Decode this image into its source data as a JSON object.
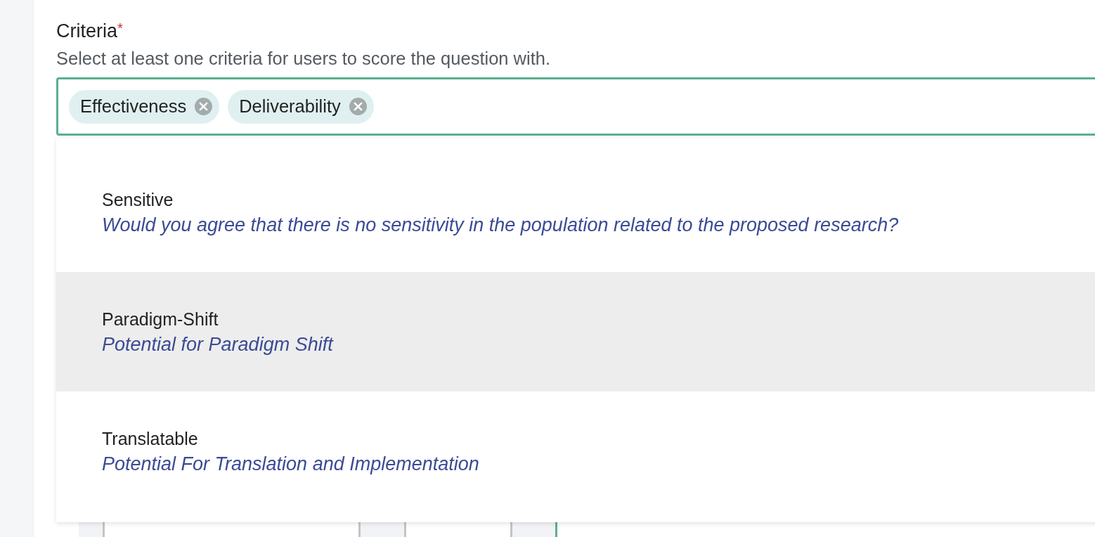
{
  "field": {
    "label": "Criteria",
    "required_mark": "*",
    "hint": "Select at least one criteria for users to score the question with.",
    "focused": true,
    "tags": [
      {
        "label": "Effectiveness"
      },
      {
        "label": "Deliverability"
      }
    ]
  },
  "dropdown": {
    "options": [
      {
        "name": "Sensitive",
        "description": "Would you agree that there is no sensitivity in the population related to the proposed research?",
        "selected": false
      },
      {
        "name": "Paradigm-Shift",
        "description": "Potential for Paradigm Shift",
        "selected": true
      },
      {
        "name": "Translatable",
        "description": "Potential For Translation and Implementation",
        "selected": false
      }
    ]
  }
}
